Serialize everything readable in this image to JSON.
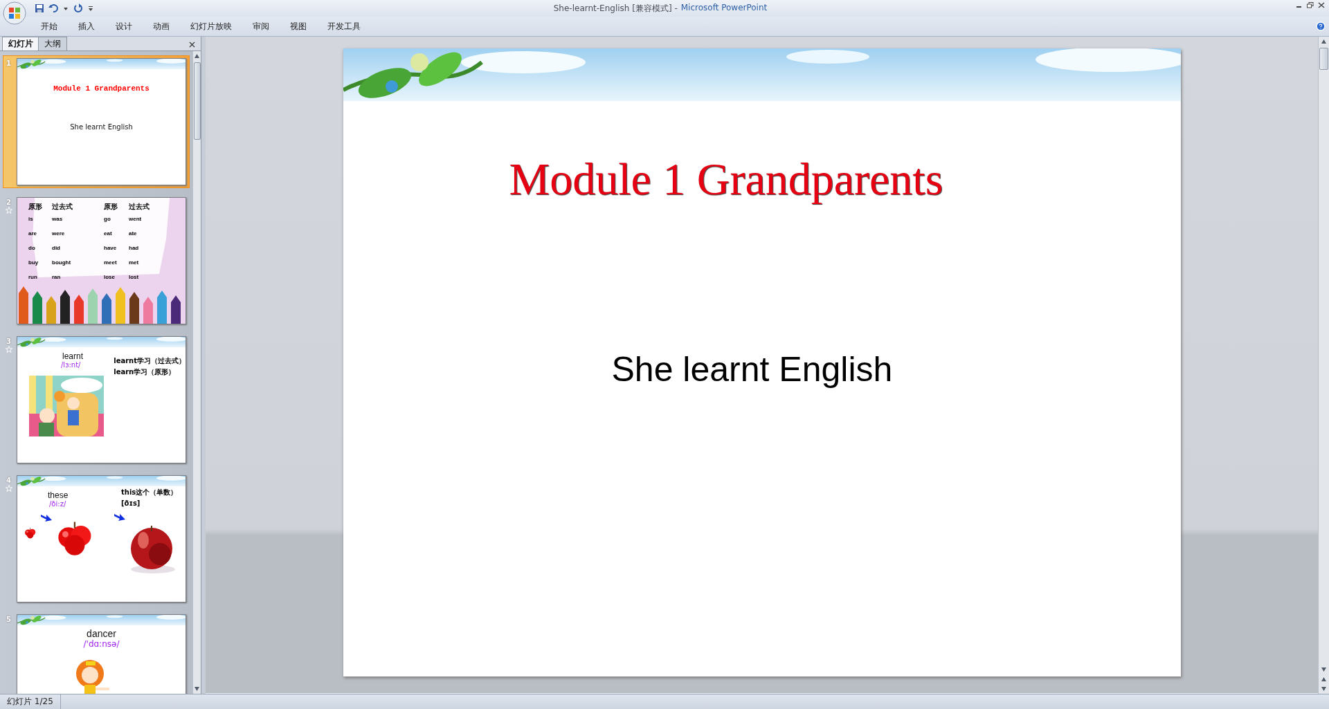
{
  "window": {
    "document_title": "She-learnt-English [兼容模式] -",
    "app_name": "Microsoft PowerPoint"
  },
  "ribbon_tabs": [
    "开始",
    "插入",
    "设计",
    "动画",
    "幻灯片放映",
    "审阅",
    "视图",
    "开发工具"
  ],
  "panel_tabs": [
    {
      "label": "幻灯片",
      "selected": true
    },
    {
      "label": "大纲",
      "selected": false
    }
  ],
  "slides": [
    {
      "number": "1",
      "selected": true,
      "animated": false,
      "kind": "title",
      "title": "Module 1 Grandparents",
      "subtitle": "She learnt English"
    },
    {
      "number": "2",
      "selected": false,
      "animated": true,
      "kind": "table",
      "columns": [
        "原形",
        "过去式",
        "原形",
        "过去式"
      ],
      "rows": [
        [
          "is",
          "was",
          "go",
          "went"
        ],
        [
          "are",
          "were",
          "eat",
          "ate"
        ],
        [
          "do",
          "did",
          "have",
          "had"
        ],
        [
          "buy",
          "bought",
          "meet",
          "met"
        ],
        [
          "run",
          "ran",
          "lose",
          "lost"
        ]
      ]
    },
    {
      "number": "3",
      "selected": false,
      "animated": true,
      "kind": "word_scene",
      "word": "learnt",
      "phonetic": "/lɜ:nt/",
      "notes": [
        "learnt学习（过去式）",
        "learn学习（原形）"
      ]
    },
    {
      "number": "4",
      "selected": false,
      "animated": true,
      "kind": "word_compare",
      "word": "these",
      "phonetic": "/ði:z/",
      "notes": [
        "this这个（单数）",
        "[ðɪs]"
      ]
    },
    {
      "number": "5",
      "selected": false,
      "animated": false,
      "kind": "word_figure",
      "word": "dancer",
      "phonetic": "/'dɑ:nsə/"
    }
  ],
  "main_slide": {
    "title": "Module 1 Grandparents",
    "subtitle": "She learnt English"
  },
  "status_bar": {
    "slide_indicator": "幻灯片 1/25"
  }
}
